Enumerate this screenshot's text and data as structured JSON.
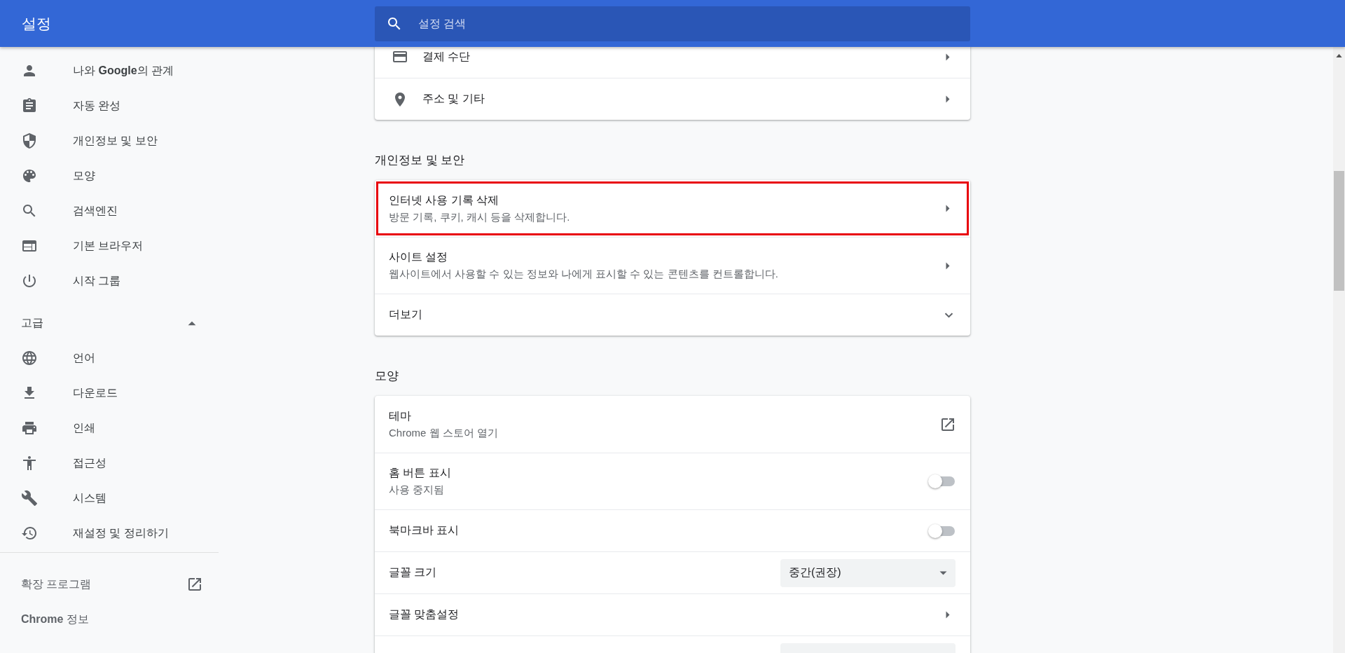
{
  "header": {
    "title": "설정",
    "search": {
      "placeholder": "설정 검색"
    }
  },
  "sidebar": {
    "items": [
      {
        "label": "나와 **Google**의 관계",
        "selected": false
      },
      {
        "label": "자동 완성",
        "selected": false
      },
      {
        "label": "개인정보 및 보안",
        "selected": false
      },
      {
        "label": "모양",
        "selected": false
      },
      {
        "label": "검색엔진",
        "selected": false
      },
      {
        "label": "기본 브라우저",
        "selected": false
      },
      {
        "label": "시작 그룹",
        "selected": false
      }
    ],
    "advanced": {
      "label": "고급",
      "expanded": true,
      "items": [
        {
          "label": "언어",
          "selected": false
        },
        {
          "label": "다운로드",
          "selected": false
        },
        {
          "label": "인쇄",
          "selected": false
        },
        {
          "label": "접근성",
          "selected": false
        },
        {
          "label": "시스템",
          "selected": false
        },
        {
          "label": "재설정 및 정리하기",
          "selected": false
        }
      ]
    },
    "footer": [
      {
        "kind": "external",
        "label": "확장 프로그램"
      },
      {
        "kind": "link",
        "label": "**Chrome** 정보"
      }
    ]
  },
  "sections": [
    {
      "rows": [
        {
          "kind": "arrow",
          "title": "결제 수단",
          "highlighted": false
        },
        {
          "kind": "arrow",
          "title": "주소 및 기타",
          "highlighted": false
        }
      ]
    },
    {
      "heading": "개인정보 및 보안",
      "rows": [
        {
          "kind": "arrow",
          "title": "인터넷 사용 기록 삭제",
          "subtitle": "방문 기록, 쿠키, 캐시 등을 삭제합니다.",
          "highlighted": true
        },
        {
          "kind": "arrow",
          "title": "사이트 설정",
          "subtitle": "웹사이트에서 사용할 수 있는 정보와 나에게 표시할 수 있는 콘텐츠를 컨트롤합니다.",
          "highlighted": false
        },
        {
          "kind": "expand",
          "title": "더보기",
          "expanded": false,
          "highlighted": false
        }
      ]
    },
    {
      "heading": "모양",
      "rows": [
        {
          "kind": "external",
          "title": "테마",
          "subtitle": "Chrome 웹 스토어 열기",
          "highlighted": false
        },
        {
          "kind": "toggle",
          "title": "홈 버튼 표시",
          "subtitle": "사용 중지됨",
          "on": false,
          "highlighted": false
        },
        {
          "kind": "toggle",
          "title": "북마크바 표시",
          "on": false,
          "highlighted": false
        },
        {
          "kind": "dropdown",
          "title": "글꼴 크기",
          "value": "중간(권장)",
          "highlighted": false
        },
        {
          "kind": "arrow",
          "title": "글꼴 맞춤설정",
          "highlighted": false
        },
        {
          "kind": "dropdown",
          "highlighted": false
        }
      ]
    }
  ]
}
